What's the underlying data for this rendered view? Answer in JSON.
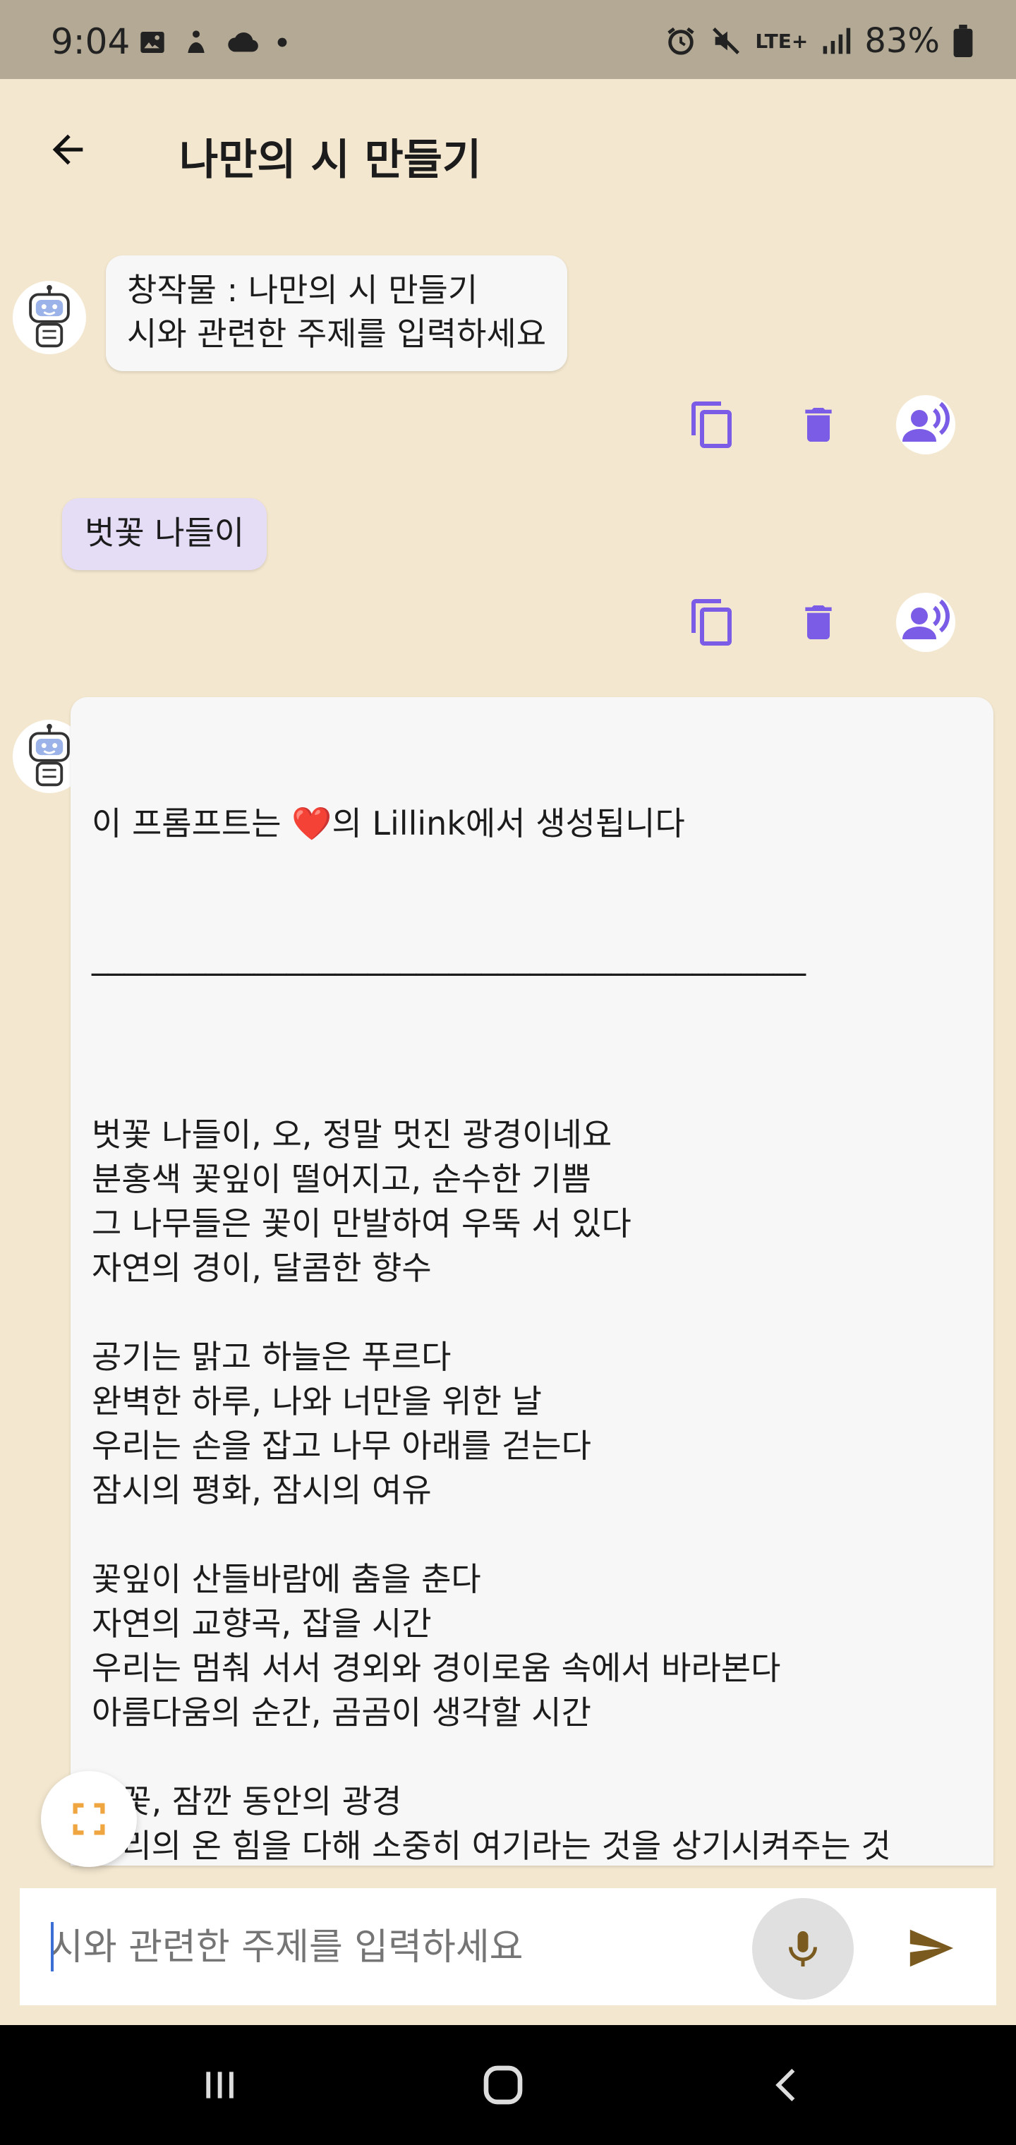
{
  "status_bar": {
    "time": "9:04",
    "battery": "83%",
    "network": "LTE+",
    "left_icons": [
      "gallery-icon",
      "accessibility-icon",
      "cloud-icon",
      "dot-icon"
    ],
    "right_icons": [
      "alarm-icon",
      "mute-icon",
      "signal-icon",
      "battery-icon"
    ]
  },
  "app_bar": {
    "title": "나만의 시 만들기",
    "back_icon": "arrow-back-icon"
  },
  "messages": [
    {
      "role": "bot",
      "lines": [
        "창작물 : 나만의 시 만들기",
        "시와 관련한 주제를 입력하세요"
      ]
    },
    {
      "role": "user",
      "text": "벗꽃 나들이"
    }
  ],
  "actions": {
    "icons": [
      "copy-icon",
      "delete-icon",
      "speak-icon"
    ]
  },
  "poem": {
    "header_prefix": "이 프롬프트는 ",
    "header_heart": "❤️",
    "header_suffix": "의 Lillink에서 생성됩니다",
    "divider": "____________________________________________",
    "body": "벗꽃 나들이, 오, 정말 멋진 광경이네요\n분홍색 꽃잎이 떨어지고, 순수한 기쁨\n그 나무들은 꽃이 만발하여 우뚝 서 있다\n자연의 경이, 달콤한 향수\n\n공기는 맑고 하늘은 푸르다\n완벽한 하루, 나와 너만을 위한 날\n우리는 손을 잡고 나무 아래를 걷는다\n잠시의 평화, 잠시의 여유\n\n꽃잎이 산들바람에 춤을 춘다\n자연의 교향곡, 잡을 시간\n우리는 멈춰 서서 경외와 경이로움 속에서 바라본다\n아름다움의 순간, 곰곰이 생각할 시간\n\n벗꽃, 잠깐 동안의 광경\n우리의 온 힘을 다해 소중히 여기라는 것을 상기시켜주는 것\n인생은 짧고, 이런 순간들은\n우리가 소중히 여기는 자들, 우리가 붙잡는 자들이다\n\n그러니 벗꽃나무 아래를 걷자\n그리고 자연의 달콤한 해방의 아름다움을 즐기세요\n자른 의 수가 우리는 정말으로 가득하다"
  },
  "input": {
    "placeholder": "시와 관련한 주제를 입력하세요",
    "value": ""
  },
  "colors": {
    "background": "#f3e7cf",
    "status_bar": "#b3a994",
    "accent_purple": "#7b5ce6",
    "user_bubble": "#e5dcf6",
    "send_brown": "#7a5a1e",
    "expand_orange": "#f0a640"
  }
}
